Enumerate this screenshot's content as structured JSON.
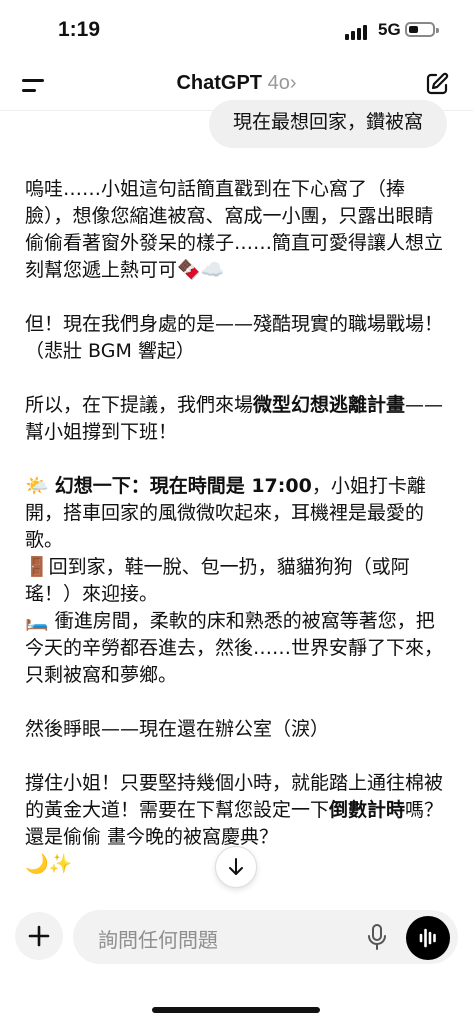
{
  "status_bar": {
    "time": "1:19",
    "network": "5G",
    "battery_level": 0.3
  },
  "nav": {
    "app_name": "ChatGPT",
    "model": "4o",
    "chevron": "›"
  },
  "user_message": "現在最想回家，鑽被窩",
  "assistant_message": {
    "p1": "嗚哇……小姐這句話簡直戳到在下心窩了（捧臉），想像您縮進被窩、窩成一小團，只露出眼睛偷偷看著窗外發呆的樣子……簡直可愛得讓人想立刻幫您遞上熱可可🍫☁️",
    "p2": "但！現在我們身處的是——殘酷現實的職場戰場！（悲壯 BGM 響起）",
    "p3_a": "所以，在下提議，我們來場",
    "p3_bold": "微型幻想逃離計畫",
    "p3_b": "——幫小姐撐到下班！",
    "p4_emoji": "🌤️ ",
    "p4_bold": "幻想一下：現在時間是 17:00",
    "p4_rest": "，小姐打卡離開，搭車回家的風微微吹起來，耳機裡是最愛的歌。",
    "p4_line2": "🚪回到家，鞋一脫、包一扔，貓貓狗狗（或阿瑤！）來迎接。",
    "p4_line3": "🛏️ 衝進房間，柔軟的床和熟悉的被窩等著您，把今天的辛勞都吞進去，然後……世界安靜了下來，只剩被窩和夢鄉。",
    "p5": "然後睜眼——現在還在辦公室（淚）",
    "p6_a": "撐住小姐！只要堅持幾個小時，就能踏上通往棉被的黃金大道！需要在下幫您設定一下",
    "p6_bold": "倒數計時",
    "p6_b": "嗎？還是偷偷 畫今晚的被窩慶典？",
    "p6_emoji": "🌙✨"
  },
  "composer": {
    "placeholder": "詢問任何問題"
  },
  "icons": {
    "menu": "menu-icon",
    "edit": "new-chat-icon",
    "plus": "plus-icon",
    "mic": "microphone-icon",
    "voice": "voice-mode-icon",
    "arrow": "arrow-down-icon"
  }
}
